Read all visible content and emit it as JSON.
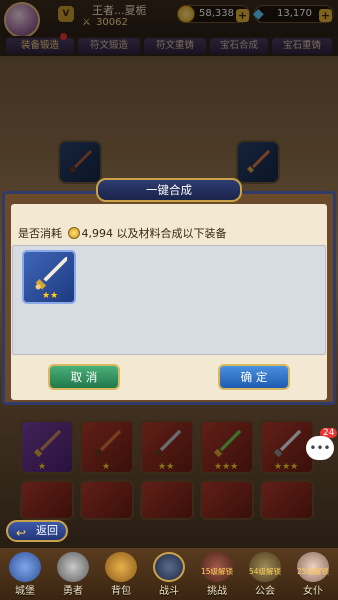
{
  "player": {
    "name": "王者...夏栀",
    "power": "30062",
    "vip": "V"
  },
  "currency": {
    "gold": "58,338",
    "gems": "13,170",
    "plus": "+"
  },
  "tabs": [
    "装备锻造",
    "符文锻造",
    "符文重铸",
    "宝石合成",
    "宝石重铸"
  ],
  "dialog": {
    "title": "一键合成",
    "message_prefix": "是否消耗",
    "cost": "4,994",
    "message_suffix": "以及材料合成以下装备",
    "item_stars": "★★",
    "cancel_label": "取 消",
    "confirm_label": "确 定"
  },
  "inventory": {
    "stars": [
      "★",
      "★",
      "★★",
      "★★★",
      "★★★"
    ]
  },
  "chat": {
    "badge": "24",
    "icon": "•••"
  },
  "back_label": "返回",
  "nav": [
    {
      "label": "城堡",
      "icon": "castle-icon"
    },
    {
      "label": "勇者",
      "icon": "helmet-icon"
    },
    {
      "label": "背包",
      "icon": "chest-icon"
    },
    {
      "label": "战斗",
      "icon": "crossed-swords-icon"
    },
    {
      "label": "挑战",
      "icon": "challenge-icon",
      "ribbon": "15级解锁"
    },
    {
      "label": "公会",
      "icon": "guild-icon",
      "ribbon": "54级解锁"
    },
    {
      "label": "女仆",
      "icon": "maid-icon",
      "ribbon": "25级解锁"
    }
  ],
  "colors": {
    "accent_gold": "#c9a24a",
    "dialog_blue": "#2f3c6a",
    "cancel_green": "#21784a",
    "confirm_blue": "#1f5bb0"
  }
}
